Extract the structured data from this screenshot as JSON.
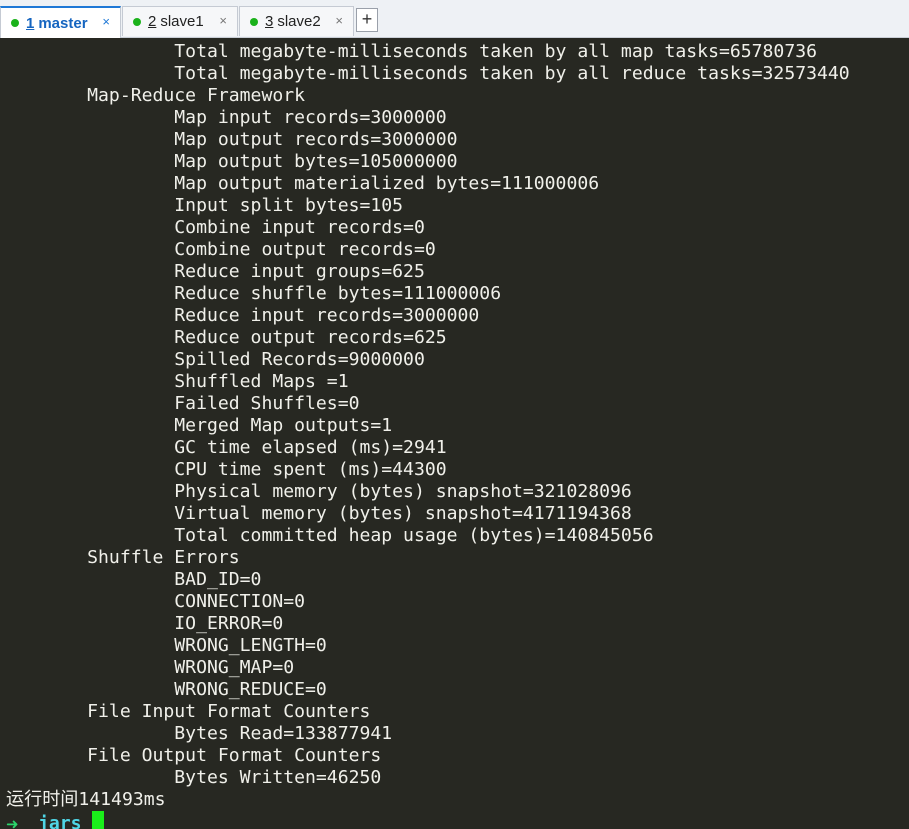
{
  "tabs": [
    {
      "number": "1",
      "label": "master",
      "active": true,
      "status_color": "#1bb21b"
    },
    {
      "number": "2",
      "label": "slave1",
      "active": false,
      "status_color": "#1bb21b"
    },
    {
      "number": "3",
      "label": "slave2",
      "active": false,
      "status_color": "#1bb21b"
    }
  ],
  "tab_close_glyph": "×",
  "tab_add_glyph": "+",
  "terminal": {
    "lines": [
      "                Total megabyte-milliseconds taken by all map tasks=65780736",
      "                Total megabyte-milliseconds taken by all reduce tasks=32573440",
      "        Map-Reduce Framework",
      "                Map input records=3000000",
      "                Map output records=3000000",
      "                Map output bytes=105000000",
      "                Map output materialized bytes=111000006",
      "                Input split bytes=105",
      "                Combine input records=0",
      "                Combine output records=0",
      "                Reduce input groups=625",
      "                Reduce shuffle bytes=111000006",
      "                Reduce input records=3000000",
      "                Reduce output records=625",
      "                Spilled Records=9000000",
      "                Shuffled Maps =1",
      "                Failed Shuffles=0",
      "                Merged Map outputs=1",
      "                GC time elapsed (ms)=2941",
      "                CPU time spent (ms)=44300",
      "                Physical memory (bytes) snapshot=321028096",
      "                Virtual memory (bytes) snapshot=4171194368",
      "                Total committed heap usage (bytes)=140845056",
      "        Shuffle Errors",
      "                BAD_ID=0",
      "                CONNECTION=0",
      "                IO_ERROR=0",
      "                WRONG_LENGTH=0",
      "                WRONG_MAP=0",
      "                WRONG_REDUCE=0",
      "        File Input Format Counters",
      "                Bytes Read=133877941",
      "        File Output Format Counters",
      "                Bytes Written=46250",
      "运行时间141493ms"
    ],
    "prompt_arrow": "➜",
    "prompt_dir": "jars",
    "colors": {
      "background": "#272822",
      "foreground": "#f0f0ea",
      "prompt_arrow": "#2bd46b",
      "prompt_dir": "#4fd6e6",
      "cursor": "#1aee1a"
    }
  }
}
